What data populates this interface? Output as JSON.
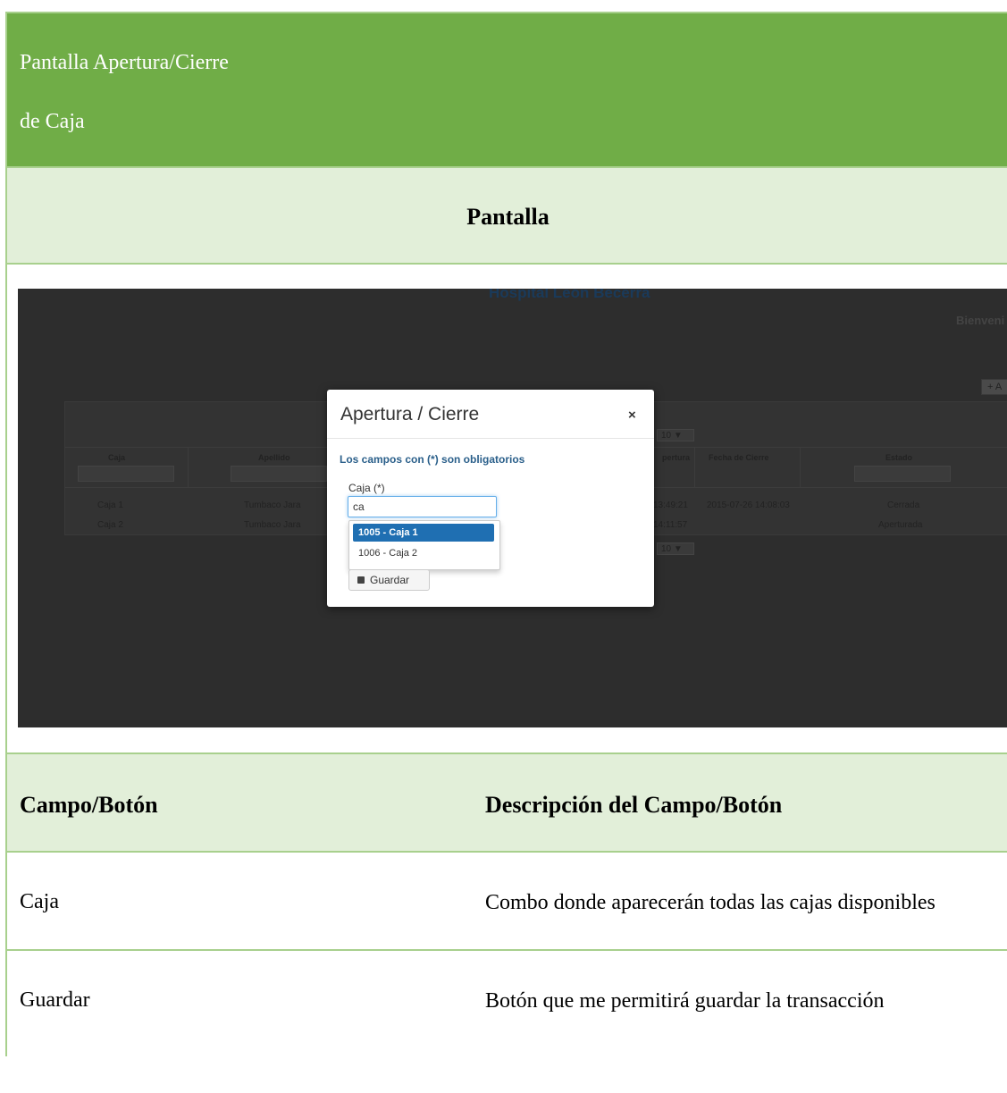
{
  "title": {
    "line1": "Pantalla Apertura/Cierre",
    "line2": "de Caja"
  },
  "section_header": "Pantalla",
  "app": {
    "hospital": "Hospital León Becerra",
    "welcome": "Bienveni",
    "add_button": "+ A",
    "pager_top": "10 ▼",
    "pager_bottom": "10 ▼",
    "columns": [
      "Caja",
      "Apellido",
      "pertura",
      "Fecha de Cierre",
      "Estado"
    ],
    "rows": [
      {
        "caja": "Caja 1",
        "apellido": "Tumbaco Jara",
        "apertura": "13:49:21",
        "cierre": "2015-07-26 14:08:03",
        "estado": "Cerrada"
      },
      {
        "caja": "Caja 2",
        "apellido": "Tumbaco Jara",
        "apertura": "14:11:57",
        "cierre": "",
        "estado": "Aperturada"
      }
    ],
    "modal": {
      "title": "Apertura / Cierre",
      "close": "×",
      "required_note": "Los campos con (*) son obligatorios",
      "field_label": "Caja (*)",
      "field_value": "ca",
      "options": [
        "1005 - Caja 1",
        "1006 - Caja 2"
      ],
      "save_label": "Guardar"
    }
  },
  "table_header": {
    "col1": "Campo/Botón",
    "col2": "Descripción del Campo/Botón"
  },
  "rows": [
    {
      "name": "Caja",
      "description": "Combo donde aparecerán todas las cajas disponibles"
    },
    {
      "name": "Guardar",
      "description": "Botón que me permitirá guardar la transacción"
    }
  ],
  "colors": {
    "title_bg": "#70ad47",
    "section_bg": "#e2efd9",
    "border": "#a8d08d"
  }
}
